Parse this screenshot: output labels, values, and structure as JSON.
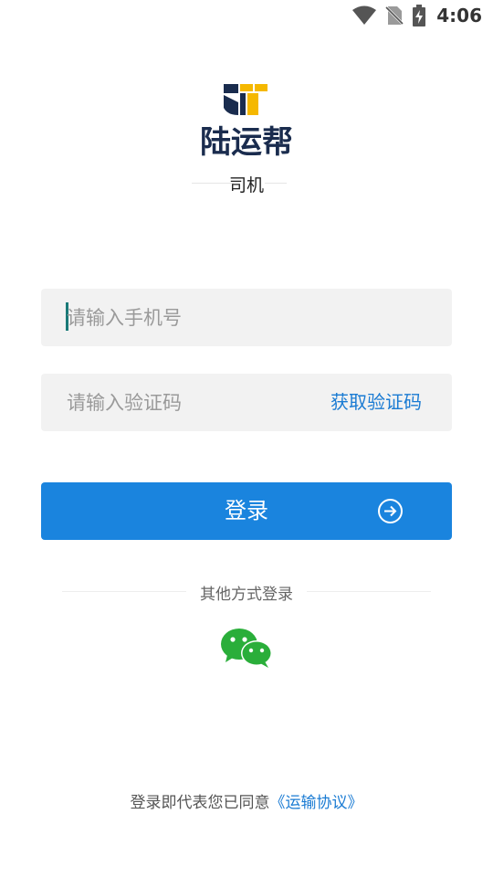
{
  "status_bar": {
    "time": "4:06",
    "icons": [
      "wifi-icon",
      "no-sim-icon",
      "battery-charging-icon"
    ]
  },
  "logo": {
    "brand_name": "陆运帮",
    "role": "司机",
    "colors": {
      "navy": "#1a2c4e",
      "yellow": "#f5b800",
      "blue": "#1a84de"
    }
  },
  "form": {
    "phone_placeholder": "请输入手机号",
    "code_placeholder": "请输入验证码",
    "get_code_label": "获取验证码"
  },
  "login_button": {
    "label": "登录",
    "icon": "arrow-right-circle-icon"
  },
  "other_login": {
    "label": "其他方式登录",
    "icon": "wechat-icon"
  },
  "agreement": {
    "prefix": "登录即代表您已同意",
    "link_text": "《运输协议》"
  }
}
